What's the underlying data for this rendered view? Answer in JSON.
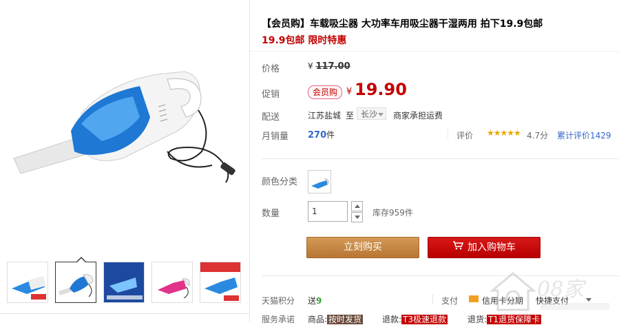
{
  "product": {
    "title": "【会员购】车载吸尘器 大功率车用吸尘器干湿两用 拍下19.9包邮",
    "subtitle": "19.9包邮 限时特惠"
  },
  "price": {
    "label": "价格",
    "currency": "¥",
    "original": "117.00"
  },
  "promo": {
    "label": "促销",
    "tag": "会员购",
    "currency": "¥",
    "price": "19.90"
  },
  "shipping": {
    "label": "配送",
    "from": "江苏盐城",
    "to_label": "至",
    "to": "长沙",
    "fee": "商家承担运费"
  },
  "sales": {
    "label": "月销量",
    "count": "270",
    "unit": "件"
  },
  "reviews": {
    "label": "评价",
    "stars": "★★★★★",
    "score": "4.7分",
    "count_text": "累计评价1429"
  },
  "color": {
    "label": "颜色分类"
  },
  "quantity": {
    "label": "数量",
    "value": "1",
    "stock": "库存959件"
  },
  "actions": {
    "buy_now": "立刻购买",
    "add_to_cart": "加入购物车"
  },
  "points": {
    "label": "天猫积分",
    "prefix": "送",
    "value": "9"
  },
  "payment": {
    "label": "支付",
    "credit": "信用卡分期",
    "quick": "快捷支付"
  },
  "service": {
    "label": "服务承诺",
    "goods_label": "商品:",
    "goods_tag": "按时发货",
    "refund_label": "退款:",
    "refund_tag": "T3极速退款",
    "return_label": "退货:",
    "return_tag": "T1退货保障卡"
  },
  "colors": {
    "accent_red": "#c40000",
    "buy_button": "#c4843c",
    "cart_button": "#c40000",
    "link_blue": "#3366cc",
    "star_yellow": "#e9a700"
  }
}
